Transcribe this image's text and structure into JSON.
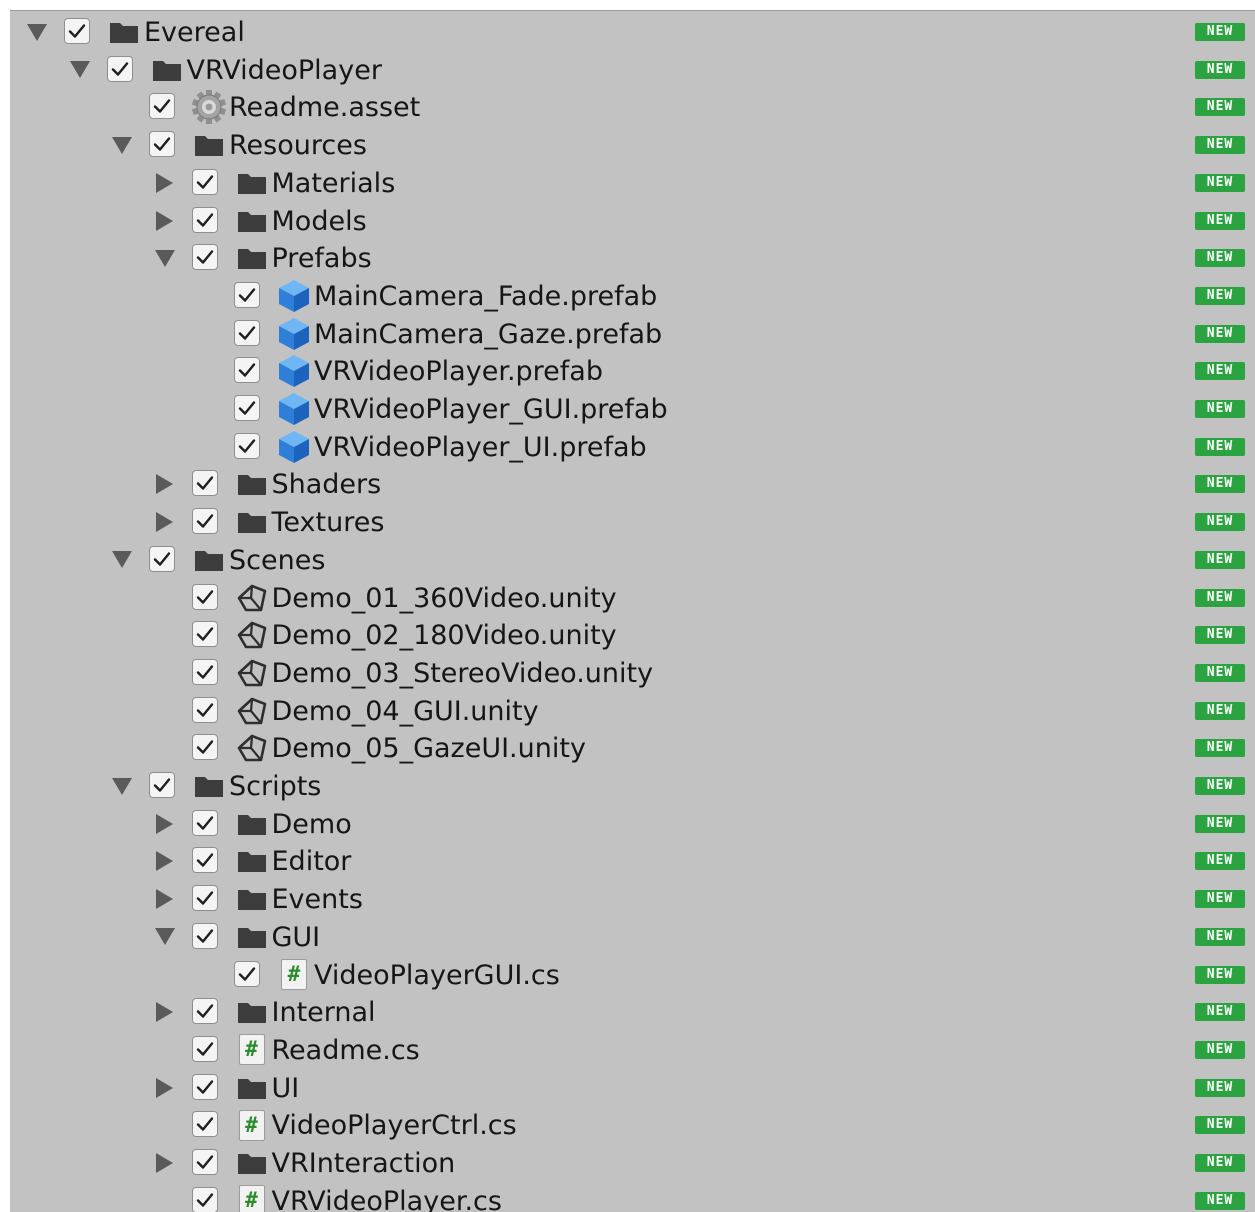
{
  "tree": {
    "badge_label": "NEW",
    "items": [
      {
        "label": "Evereal",
        "kind": "folder",
        "depth": 0,
        "expander": "expanded",
        "checked": true,
        "badge": true
      },
      {
        "label": "VRVideoPlayer",
        "kind": "folder",
        "depth": 1,
        "expander": "expanded",
        "checked": true,
        "badge": true
      },
      {
        "label": "Readme.asset",
        "kind": "asset",
        "depth": 2,
        "expander": "none",
        "checked": true,
        "badge": true
      },
      {
        "label": "Resources",
        "kind": "folder",
        "depth": 2,
        "expander": "expanded",
        "checked": true,
        "badge": true
      },
      {
        "label": "Materials",
        "kind": "folder",
        "depth": 3,
        "expander": "collapsed",
        "checked": true,
        "badge": true
      },
      {
        "label": "Models",
        "kind": "folder",
        "depth": 3,
        "expander": "collapsed",
        "checked": true,
        "badge": true
      },
      {
        "label": "Prefabs",
        "kind": "folder",
        "depth": 3,
        "expander": "expanded",
        "checked": true,
        "badge": true
      },
      {
        "label": "MainCamera_Fade.prefab",
        "kind": "prefab",
        "depth": 4,
        "expander": "none",
        "checked": true,
        "badge": true
      },
      {
        "label": "MainCamera_Gaze.prefab",
        "kind": "prefab",
        "depth": 4,
        "expander": "none",
        "checked": true,
        "badge": true
      },
      {
        "label": "VRVideoPlayer.prefab",
        "kind": "prefab",
        "depth": 4,
        "expander": "none",
        "checked": true,
        "badge": true
      },
      {
        "label": "VRVideoPlayer_GUI.prefab",
        "kind": "prefab",
        "depth": 4,
        "expander": "none",
        "checked": true,
        "badge": true
      },
      {
        "label": "VRVideoPlayer_UI.prefab",
        "kind": "prefab",
        "depth": 4,
        "expander": "none",
        "checked": true,
        "badge": true
      },
      {
        "label": "Shaders",
        "kind": "folder",
        "depth": 3,
        "expander": "collapsed",
        "checked": true,
        "badge": true
      },
      {
        "label": "Textures",
        "kind": "folder",
        "depth": 3,
        "expander": "collapsed",
        "checked": true,
        "badge": true
      },
      {
        "label": "Scenes",
        "kind": "folder",
        "depth": 2,
        "expander": "expanded",
        "checked": true,
        "badge": true
      },
      {
        "label": "Demo_01_360Video.unity",
        "kind": "scene",
        "depth": 3,
        "expander": "none",
        "checked": true,
        "badge": true
      },
      {
        "label": "Demo_02_180Video.unity",
        "kind": "scene",
        "depth": 3,
        "expander": "none",
        "checked": true,
        "badge": true
      },
      {
        "label": "Demo_03_StereoVideo.unity",
        "kind": "scene",
        "depth": 3,
        "expander": "none",
        "checked": true,
        "badge": true
      },
      {
        "label": "Demo_04_GUI.unity",
        "kind": "scene",
        "depth": 3,
        "expander": "none",
        "checked": true,
        "badge": true
      },
      {
        "label": "Demo_05_GazeUI.unity",
        "kind": "scene",
        "depth": 3,
        "expander": "none",
        "checked": true,
        "badge": true
      },
      {
        "label": "Scripts",
        "kind": "folder",
        "depth": 2,
        "expander": "expanded",
        "checked": true,
        "badge": true
      },
      {
        "label": "Demo",
        "kind": "folder",
        "depth": 3,
        "expander": "collapsed",
        "checked": true,
        "badge": true
      },
      {
        "label": "Editor",
        "kind": "folder",
        "depth": 3,
        "expander": "collapsed",
        "checked": true,
        "badge": true
      },
      {
        "label": "Events",
        "kind": "folder",
        "depth": 3,
        "expander": "collapsed",
        "checked": true,
        "badge": true
      },
      {
        "label": "GUI",
        "kind": "folder",
        "depth": 3,
        "expander": "expanded",
        "checked": true,
        "badge": true
      },
      {
        "label": "VideoPlayerGUI.cs",
        "kind": "script",
        "depth": 4,
        "expander": "none",
        "checked": true,
        "badge": true
      },
      {
        "label": "Internal",
        "kind": "folder",
        "depth": 3,
        "expander": "collapsed",
        "checked": true,
        "badge": true
      },
      {
        "label": "Readme.cs",
        "kind": "script",
        "depth": 3,
        "expander": "none",
        "checked": true,
        "badge": true
      },
      {
        "label": "UI",
        "kind": "folder",
        "depth": 3,
        "expander": "collapsed",
        "checked": true,
        "badge": true
      },
      {
        "label": "VideoPlayerCtrl.cs",
        "kind": "script",
        "depth": 3,
        "expander": "none",
        "checked": true,
        "badge": true
      },
      {
        "label": "VRInteraction",
        "kind": "folder",
        "depth": 3,
        "expander": "collapsed",
        "checked": true,
        "badge": true
      },
      {
        "label": "VRVideoPlayer.cs",
        "kind": "script",
        "depth": 3,
        "expander": "none",
        "checked": true,
        "badge": true
      }
    ]
  },
  "colors": {
    "panel_bg": "#c2c2c2",
    "badge_bg": "#2aa340",
    "prefab_blue": "#2f7fd9",
    "script_hash": "#2d8b2d",
    "folder": "#3d3d3d"
  },
  "icons": {
    "expanded": "triangle-down-icon",
    "collapsed": "triangle-right-icon",
    "folder": "folder-icon",
    "asset": "gear-asset-icon",
    "prefab": "prefab-cube-icon",
    "scene": "unity-scene-icon",
    "script": "csharp-script-icon",
    "check": "checkmark-icon"
  }
}
